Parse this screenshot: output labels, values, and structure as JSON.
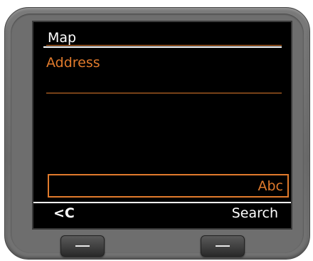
{
  "screen": {
    "title": "Map",
    "field_label": "Address",
    "input_mode": "Abc"
  },
  "softkeys": {
    "left_label": "<C",
    "right_label": "Search"
  },
  "colors": {
    "accent": "#e07a2c",
    "screen_bg": "#000000",
    "text": "#ffffff"
  }
}
